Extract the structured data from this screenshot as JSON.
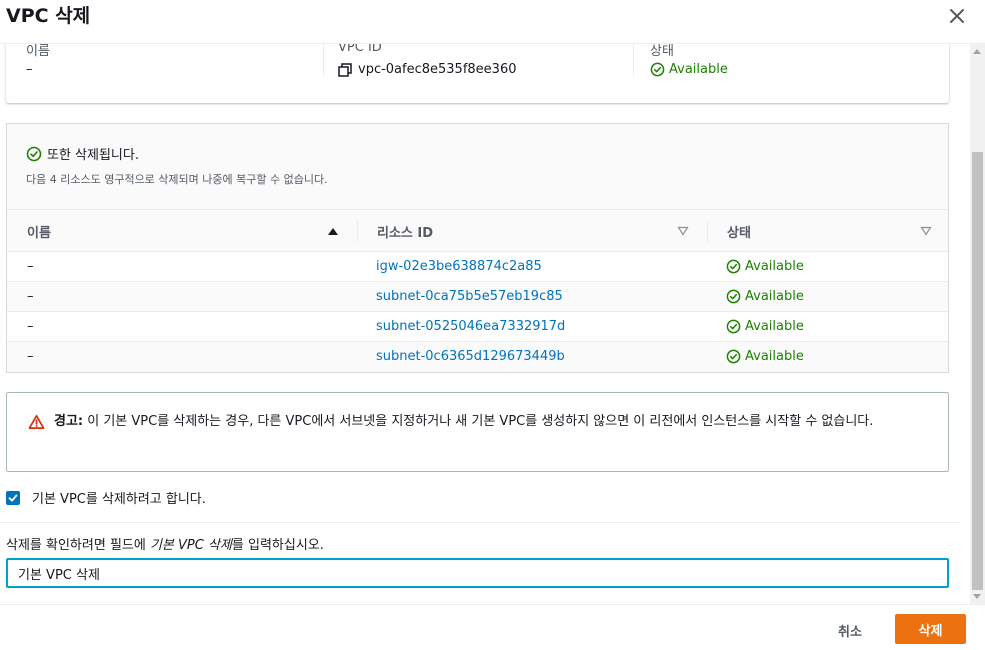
{
  "modal": {
    "title": "VPC 삭제"
  },
  "summary": {
    "name_label": "이름",
    "name_value": "–",
    "vpc_id_label": "VPC ID",
    "vpc_id_value": "vpc-0afec8e535f8ee360",
    "status_label": "상태",
    "status_value": "Available"
  },
  "resources": {
    "title": "또한 삭제됩니다.",
    "description": "다음 4 리소스도 영구적으로 삭제되며 나중에 복구할 수 없습니다.",
    "columns": [
      "이름",
      "리소스 ID",
      "상태"
    ],
    "rows": [
      {
        "name": "–",
        "id": "igw-02e3be638874c2a85",
        "status": "Available"
      },
      {
        "name": "–",
        "id": "subnet-0ca75b5e57eb19c85",
        "status": "Available"
      },
      {
        "name": "–",
        "id": "subnet-0525046ea7332917d",
        "status": "Available"
      },
      {
        "name": "–",
        "id": "subnet-0c6365d129673449b",
        "status": "Available"
      }
    ]
  },
  "warning": {
    "label": "경고:",
    "text": " 이 기본 VPC를 삭제하는 경우, 다른 VPC에서 서브넷을 지정하거나 새 기본 VPC를 생성하지 않으면 이 리전에서 인스턴스를 시작할 수 없습니다."
  },
  "acknowledge": {
    "label": "기본 VPC를 삭제하려고 합니다.",
    "checked": true
  },
  "confirm": {
    "label_prefix": "삭제를 확인하려면 필드에 ",
    "label_phrase": "기본 VPC 삭제",
    "label_suffix": "를 입력하십시오.",
    "input_value": "기본 VPC 삭제"
  },
  "footer": {
    "cancel_label": "취소",
    "delete_label": "삭제"
  },
  "colors": {
    "primary": "#ec7211",
    "link": "#0073bb",
    "success": "#1d8102",
    "warning": "#d13212",
    "focus": "#00a1c9"
  }
}
